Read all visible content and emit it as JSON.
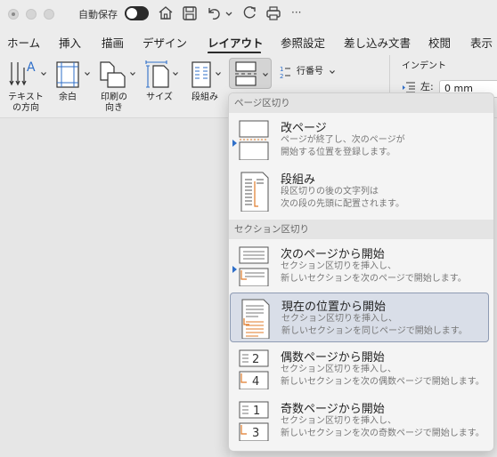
{
  "titlebar": {
    "autosave_label": "自動保存",
    "more": "···"
  },
  "tabs": [
    {
      "label": "ホーム"
    },
    {
      "label": "挿入"
    },
    {
      "label": "描画"
    },
    {
      "label": "デザイン"
    },
    {
      "label": "レイアウト",
      "active": true
    },
    {
      "label": "参照設定"
    },
    {
      "label": "差し込み文書"
    },
    {
      "label": "校閲"
    },
    {
      "label": "表示"
    }
  ],
  "ribbon": {
    "text_direction_label": "テキスト\nの方向",
    "margins_label": "余白",
    "orientation_label": "印刷の\n向き",
    "size_label": "サイズ",
    "columns_label": "段組み",
    "line_numbers_label": "行番号",
    "indent_heading": "インデント",
    "indent_left_label": "左:",
    "indent_left_value": "0 mm"
  },
  "menu": {
    "page_breaks_heading": "ページ区切り",
    "section_breaks_heading": "セクション区切り",
    "items": [
      {
        "title": "改ページ",
        "desc1": "ページが終了し、次のページが",
        "desc2": "開始する位置を登録します。",
        "icon": "page-break-icon"
      },
      {
        "title": "段組み",
        "desc1": "段区切りの後の文字列は",
        "desc2": "次の段の先頭に配置されます。",
        "icon": "column-break-icon"
      },
      {
        "title": "次のページから開始",
        "desc1": "セクション区切りを挿入し、",
        "desc2": "新しいセクションを次のページで開始します。",
        "icon": "next-page-break-icon"
      },
      {
        "title": "現在の位置から開始",
        "desc1": "セクション区切りを挿入し、",
        "desc2": "新しいセクションを同じページで開始します。",
        "icon": "continuous-break-icon",
        "selected": true
      },
      {
        "title": "偶数ページから開始",
        "desc1": "セクション区切りを挿入し、",
        "desc2": "新しいセクションを次の偶数ページで開始します。",
        "icon": "even-page-break-icon"
      },
      {
        "title": "奇数ページから開始",
        "desc1": "セクション区切りを挿入し、",
        "desc2": "新しいセクションを次の奇数ページで開始します。",
        "icon": "odd-page-break-icon"
      }
    ]
  },
  "colors": {
    "accent": "#2f6fc9",
    "orange": "#e07b2a",
    "selected_bg": "#d9dee8"
  }
}
